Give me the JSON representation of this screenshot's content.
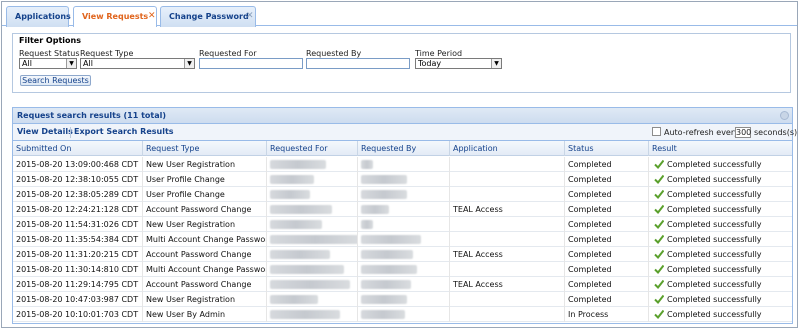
{
  "tabs": [
    {
      "label": "Applications",
      "active": false,
      "closable": false
    },
    {
      "label": "View Requests",
      "active": true,
      "closable": true
    },
    {
      "label": "Change Password",
      "active": false,
      "closable": true
    }
  ],
  "close_glyph": "✕",
  "filter": {
    "title": "Filter Options",
    "request_status": {
      "label": "Request Status",
      "value": "All"
    },
    "request_type": {
      "label": "Request Type",
      "value": "All"
    },
    "requested_for": {
      "label": "Requested For",
      "value": ""
    },
    "requested_by": {
      "label": "Requested By",
      "value": ""
    },
    "time_period": {
      "label": "Time Period",
      "value": "Today"
    },
    "search_button": "Search Requests"
  },
  "results": {
    "title": "Request search results (11 total)",
    "toolbar": {
      "view_details": "View Details",
      "export": "Export Search Results",
      "auto_refresh_label": "Auto-refresh every",
      "auto_refresh_value": "300",
      "auto_refresh_units": "seconds(s)",
      "auto_refresh_checked": false
    },
    "columns": [
      "Submitted On",
      "Request Type",
      "Requested For",
      "Requested By",
      "Application",
      "Status",
      "Result"
    ],
    "rows": [
      {
        "submitted": "2015-08-20 13:09:00:468 CDT",
        "type": "New User Registration",
        "application": "",
        "status": "Completed",
        "result": "Completed successfully"
      },
      {
        "submitted": "2015-08-20 12:38:10:055 CDT",
        "type": "User Profile Change",
        "application": "",
        "status": "Completed",
        "result": "Completed successfully"
      },
      {
        "submitted": "2015-08-20 12:38:05:289 CDT",
        "type": "User Profile Change",
        "application": "",
        "status": "Completed",
        "result": "Completed successfully"
      },
      {
        "submitted": "2015-08-20 12:24:21:128 CDT",
        "type": "Account Password Change",
        "application": "TEAL Access",
        "status": "Completed",
        "result": "Completed successfully"
      },
      {
        "submitted": "2015-08-20 11:54:31:026 CDT",
        "type": "New User Registration",
        "application": "",
        "status": "Completed",
        "result": "Completed successfully"
      },
      {
        "submitted": "2015-08-20 11:35:54:384 CDT",
        "type": "Multi Account Change Password",
        "application": "",
        "status": "Completed",
        "result": "Completed successfully"
      },
      {
        "submitted": "2015-08-20 11:31:20:215 CDT",
        "type": "Account Password Change",
        "application": "TEAL Access",
        "status": "Completed",
        "result": "Completed successfully"
      },
      {
        "submitted": "2015-08-20 11:30:14:810 CDT",
        "type": "Multi Account Change Password",
        "application": "",
        "status": "Completed",
        "result": "Completed successfully"
      },
      {
        "submitted": "2015-08-20 11:29:14:795 CDT",
        "type": "Account Password Change",
        "application": "TEAL Access",
        "status": "Completed",
        "result": "Completed successfully"
      },
      {
        "submitted": "2015-08-20 10:47:03:987 CDT",
        "type": "New User Registration",
        "application": "",
        "status": "Completed",
        "result": "Completed successfully"
      },
      {
        "submitted": "2015-08-20 10:10:01:703 CDT",
        "type": "New User By Admin",
        "application": "",
        "status": "In Process",
        "result": "Completed successfully"
      }
    ],
    "result_icon": "checkmark-icon",
    "redacted_fields": [
      "requested_for",
      "requested_by"
    ]
  },
  "colors": {
    "accent_orange": "#e0641c",
    "header_blue": "#15428b",
    "border_blue": "#99bbe8",
    "check_green": "#5aa02c"
  }
}
